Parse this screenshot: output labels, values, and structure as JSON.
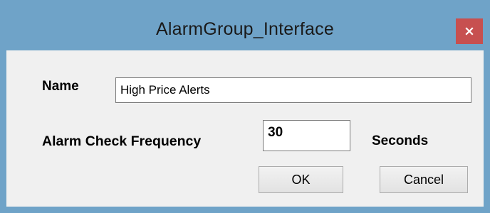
{
  "window": {
    "title": "AlarmGroup_Interface",
    "close_icon": "close-icon"
  },
  "form": {
    "name_label": "Name",
    "name_value": "High Price Alerts",
    "frequency_label": "Alarm Check Frequency",
    "frequency_value": "30",
    "frequency_unit": "Seconds"
  },
  "buttons": {
    "ok_label": "OK",
    "cancel_label": "Cancel"
  },
  "colors": {
    "titlebar": "#6fa3c8",
    "close_button": "#c75050",
    "client_bg": "#f0f0f0"
  }
}
